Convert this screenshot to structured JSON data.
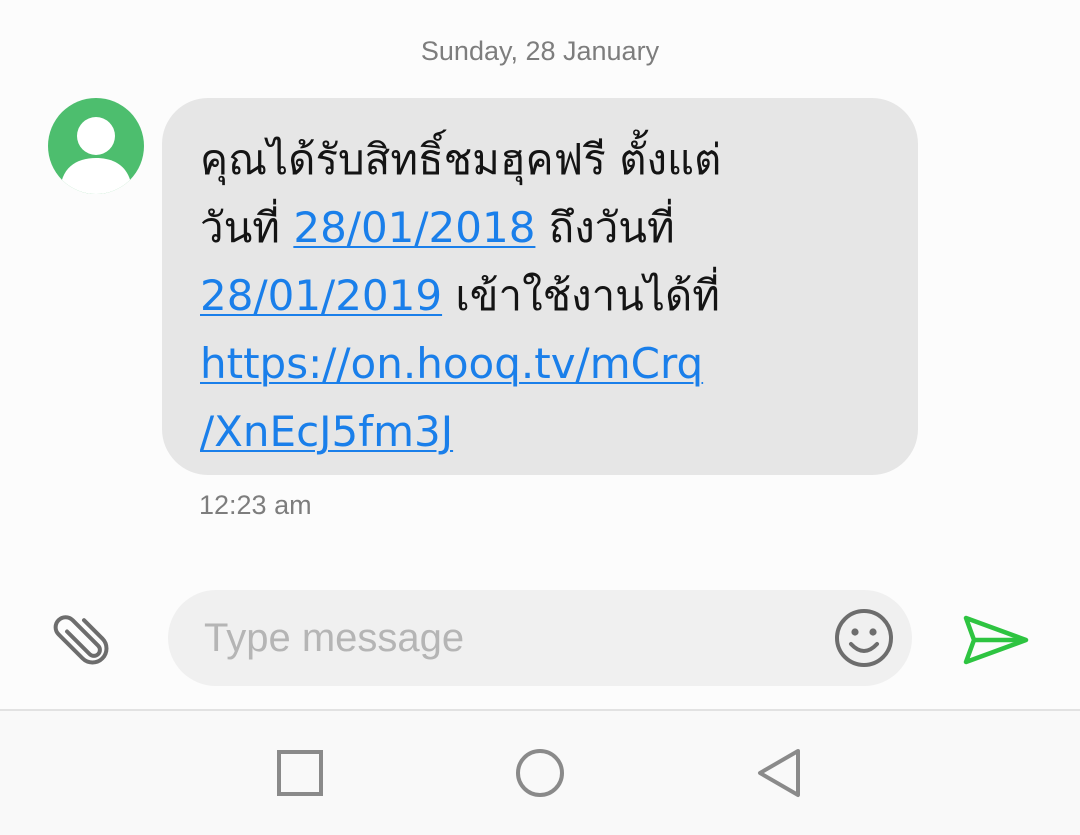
{
  "conversation": {
    "date_header": "Sunday, 28 January"
  },
  "message": {
    "line1": "คุณได้รับสิทธิ์ชมฮุคฟรี ตั้งแต่",
    "line2_prefix": "วันที่ ",
    "start_date": "28/01/2018",
    "line2_suffix": " ถึงวันที่",
    "end_date": "28/01/2019",
    "line3_suffix": " เข้าใช้งานได้ที่",
    "url_part1": "https://on.hooq.tv/mCrq",
    "url_part2": "/XnEcJ5fm3J",
    "timestamp": "12:23 am"
  },
  "composer": {
    "placeholder": "Type message",
    "value": ""
  },
  "icons": {
    "avatar": "contact-silhouette-icon",
    "attach": "paperclip-icon",
    "emoji": "smiley-icon",
    "send": "send-arrow-icon",
    "nav_recents": "square-icon",
    "nav_home": "circle-icon",
    "nav_back": "triangle-back-icon"
  },
  "colors": {
    "avatar_bg": "#4dbe6e",
    "bubble_bg": "#e6e6e6",
    "link": "#1a7fea",
    "send_icon": "#2ec441",
    "secondary_text": "#7d7d7d"
  }
}
